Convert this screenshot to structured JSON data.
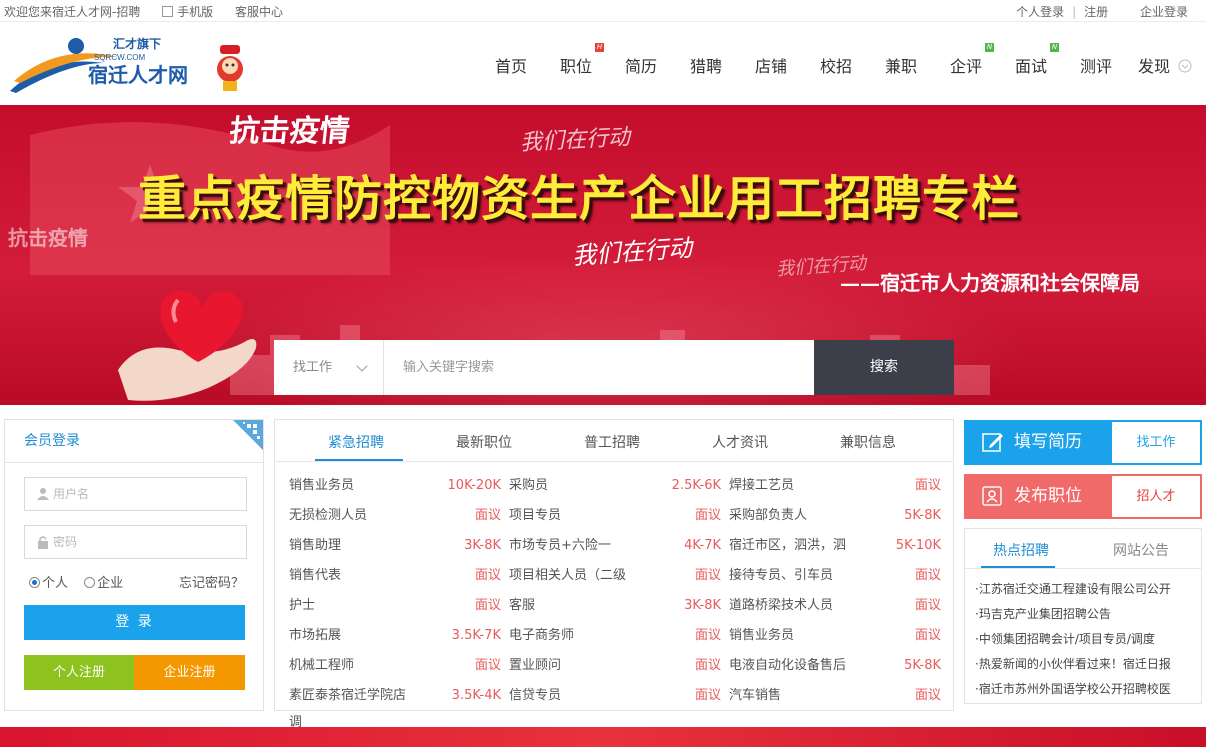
{
  "topbar": {
    "welcome": "欢迎您来宿迁人才网-招聘",
    "mobile": "手机版",
    "service": "客服中心",
    "personal_login": "个人登录",
    "register": "注册",
    "company_login": "企业登录"
  },
  "logo": {
    "tagline": "汇才旗下",
    "domain": "SQRCW.COM",
    "name": "宿迁人才网"
  },
  "nav": [
    {
      "label": "首页",
      "badge": ""
    },
    {
      "label": "职位",
      "badge": "H"
    },
    {
      "label": "简历",
      "badge": ""
    },
    {
      "label": "猎聘",
      "badge": ""
    },
    {
      "label": "店铺",
      "badge": ""
    },
    {
      "label": "校招",
      "badge": ""
    },
    {
      "label": "兼职",
      "badge": ""
    },
    {
      "label": "企评",
      "badge": "N"
    },
    {
      "label": "面试",
      "badge": "N"
    },
    {
      "label": "测评",
      "badge": ""
    },
    {
      "label": "发现",
      "badge": ""
    }
  ],
  "banner": {
    "t1": "抗击疫情",
    "t2": "我们在行动",
    "t3": "抗击疫情",
    "t4": "我们在行动",
    "t5": "我们在行动",
    "headline": "重点疫情防控物资生产企业用工招聘专栏",
    "signature": "——宿迁市人力资源和社会保障局"
  },
  "search": {
    "category": "找工作",
    "placeholder": "输入关键字搜索",
    "button": "搜索"
  },
  "login": {
    "title": "会员登录",
    "username_placeholder": "用户名",
    "password_placeholder": "密码",
    "role_personal": "个人",
    "role_company": "企业",
    "forgot": "忘记密码？",
    "login_button": "登 录",
    "register_personal": "个人注册",
    "register_company": "企业注册"
  },
  "jobs": {
    "tabs": [
      "紧急招聘",
      "最新职位",
      "普工招聘",
      "人才资讯",
      "兼职信息"
    ],
    "rows": [
      [
        {
          "title": "销售业务员",
          "salary": "10K-20K"
        },
        {
          "title": "采购员",
          "salary": "2.5K-6K"
        },
        {
          "title": "焊接工艺员",
          "salary": "面议"
        }
      ],
      [
        {
          "title": "无损检测人员",
          "salary": "面议"
        },
        {
          "title": "项目专员",
          "salary": "面议"
        },
        {
          "title": "采购部负责人",
          "salary": "5K-8K"
        }
      ],
      [
        {
          "title": "销售助理",
          "salary": "3K-8K"
        },
        {
          "title": "市场专员+六险一",
          "salary": "4K-7K"
        },
        {
          "title": "宿迁市区，泗洪，泗",
          "salary": "5K-10K"
        }
      ],
      [
        {
          "title": "销售代表",
          "salary": "面议"
        },
        {
          "title": "项目相关人员（二级",
          "salary": "面议"
        },
        {
          "title": "接待专员、引车员",
          "salary": "面议"
        }
      ],
      [
        {
          "title": "护士",
          "salary": "面议"
        },
        {
          "title": "客服",
          "salary": "3K-8K"
        },
        {
          "title": "道路桥梁技术人员",
          "salary": "面议"
        }
      ],
      [
        {
          "title": "市场拓展",
          "salary": "3.5K-7K"
        },
        {
          "title": "电子商务师",
          "salary": "面议"
        },
        {
          "title": "销售业务员",
          "salary": "面议"
        }
      ],
      [
        {
          "title": "机械工程师",
          "salary": "面议"
        },
        {
          "title": "置业顾问",
          "salary": "面议"
        },
        {
          "title": "电液自动化设备售后",
          "salary": "5K-8K"
        }
      ],
      [
        {
          "title": "素匠泰茶宿迁学院店",
          "salary": "3.5K-4K"
        },
        {
          "title": "信贷专员",
          "salary": "面议"
        },
        {
          "title": "汽车销售",
          "salary": "面议"
        }
      ]
    ],
    "extra": "调"
  },
  "side": {
    "resume_main": "填写简历",
    "resume_sub": "找工作",
    "post_main": "发布职位",
    "post_sub": "招人才",
    "tabs": [
      "热点招聘",
      "网站公告"
    ],
    "news": [
      "·江苏宿迁交通工程建设有限公司公开",
      "·玛吉克产业集团招聘公告",
      "·中领集团招聘会计/项目专员/调度",
      "·热爱新闻的小伙伴看过来！宿迁日报",
      "·宿迁市苏州外国语学校公开招聘校医"
    ]
  },
  "colors": {
    "accent": "#1aa3ea",
    "brand_blue": "#1f8dd6",
    "salary_red": "#e85a5a",
    "banner_red": "#c40d2c",
    "post_red": "#f06a6a",
    "green": "#8dc21f",
    "orange": "#f39800"
  }
}
